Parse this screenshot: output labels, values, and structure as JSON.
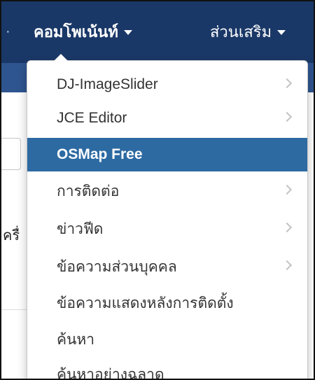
{
  "menubar": {
    "active_tab": "คอมโพเน้นท์",
    "extras_tab": "ส่วนเสริม"
  },
  "background": {
    "fragment": "ครื่"
  },
  "dropdown": {
    "items": [
      {
        "label": "DJ-ImageSlider",
        "has_submenu": true
      },
      {
        "label": "JCE Editor",
        "has_submenu": true
      },
      {
        "label": "OSMap Free",
        "has_submenu": false,
        "selected": true
      },
      {
        "label": "การติดต่อ",
        "has_submenu": true
      },
      {
        "label": "ข่าวฟีด",
        "has_submenu": true
      },
      {
        "label": "ข้อความส่วนบุคคล",
        "has_submenu": true
      },
      {
        "label": "ข้อความแสดงหลังการติดตั้ง",
        "has_submenu": false
      },
      {
        "label": "ค้นหา",
        "has_submenu": false
      },
      {
        "label": "ค้นหาอย่างฉลาด",
        "has_submenu": false
      }
    ]
  },
  "colors": {
    "menubar_bg": "#1a3867",
    "subbar_bg": "#2f5590",
    "selected_bg": "#2d6aa2"
  }
}
